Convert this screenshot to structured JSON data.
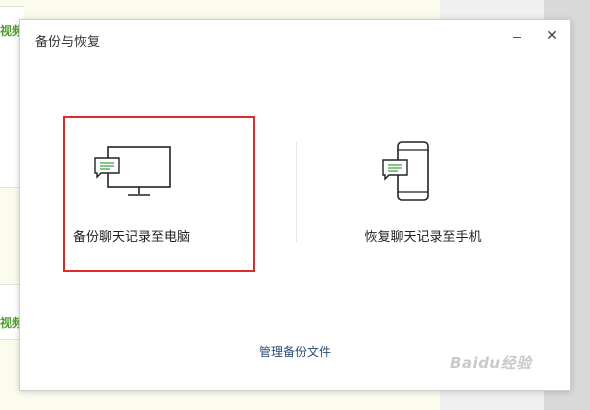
{
  "background": {
    "label_1": "视频",
    "label_2": "视频"
  },
  "dialog": {
    "title": "备份与恢复",
    "minimize_glyph": "—",
    "close_glyph": "✕",
    "options": {
      "backup_label": "备份聊天记录至电脑",
      "backup_icon": "monitor-chat-icon",
      "restore_label": "恢复聊天记录至手机",
      "restore_icon": "phone-chat-icon"
    },
    "manage_link": "管理备份文件"
  },
  "watermark": "Baidu经验",
  "colors": {
    "highlight_border": "#e0292b",
    "chat_green": "#4caf50",
    "link": "#2a4b78",
    "bg_label_green": "#4a9e2b"
  }
}
